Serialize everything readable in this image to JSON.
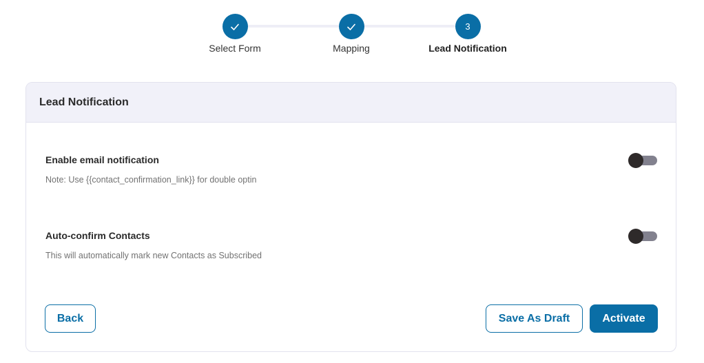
{
  "stepper": {
    "steps": [
      {
        "label": "Select Form",
        "state": "completed",
        "icon": "check-icon"
      },
      {
        "label": "Mapping",
        "state": "completed",
        "icon": "check-icon"
      },
      {
        "label": "Lead Notification",
        "state": "active",
        "number": "3"
      }
    ]
  },
  "card": {
    "title": "Lead Notification",
    "settings": [
      {
        "title": "Enable email notification",
        "note": "Note: Use {{contact_confirmation_link}} for double optin",
        "enabled": false
      },
      {
        "title": "Auto-confirm Contacts",
        "note": "This will automatically mark new Contacts as Subscribed",
        "enabled": false
      }
    ]
  },
  "actions": {
    "back_label": "Back",
    "save_draft_label": "Save As Draft",
    "activate_label": "Activate"
  },
  "colors": {
    "primary": "#0a6ea6",
    "header_bg": "#f1f1f9",
    "toggle_track_off": "#82818e",
    "toggle_knob": "#2e2a2a"
  }
}
